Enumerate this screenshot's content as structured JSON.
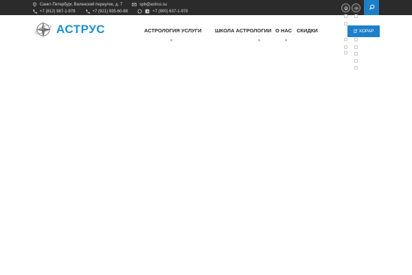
{
  "topbar": {
    "address": "Санкт-Петербург, Виленский переулок, д. 7",
    "email": "spb@astrus.su",
    "phone1": "+7 (812) 987-1-978",
    "phone2": "+7 (921) 935-60-88",
    "phone3": "+7 (900) 637-1-978",
    "icons": [
      "location-icon",
      "mail-icon",
      "phone-icon",
      "whatsapp-icon",
      "telegram-icon",
      "search-icon"
    ]
  },
  "header": {
    "logo_text": "АСТРУС",
    "nav": [
      {
        "label": "АСТРОЛОГИЯ",
        "has_submenu": true
      },
      {
        "label": "УСЛУГИ",
        "has_submenu": false
      },
      {
        "label": "ШКОЛА АСТРОЛОГИИ",
        "has_submenu": true
      },
      {
        "label": "О НАС",
        "has_submenu": true
      },
      {
        "label": "СКИДКИ",
        "has_submenu": false
      }
    ],
    "cta_label": "ХОРАР"
  },
  "colors": {
    "topbar_bg": "#2b2b2b",
    "accent": "#1d7fc9",
    "logo": "#1c8fd0",
    "nav_text": "#2a2a2a"
  }
}
